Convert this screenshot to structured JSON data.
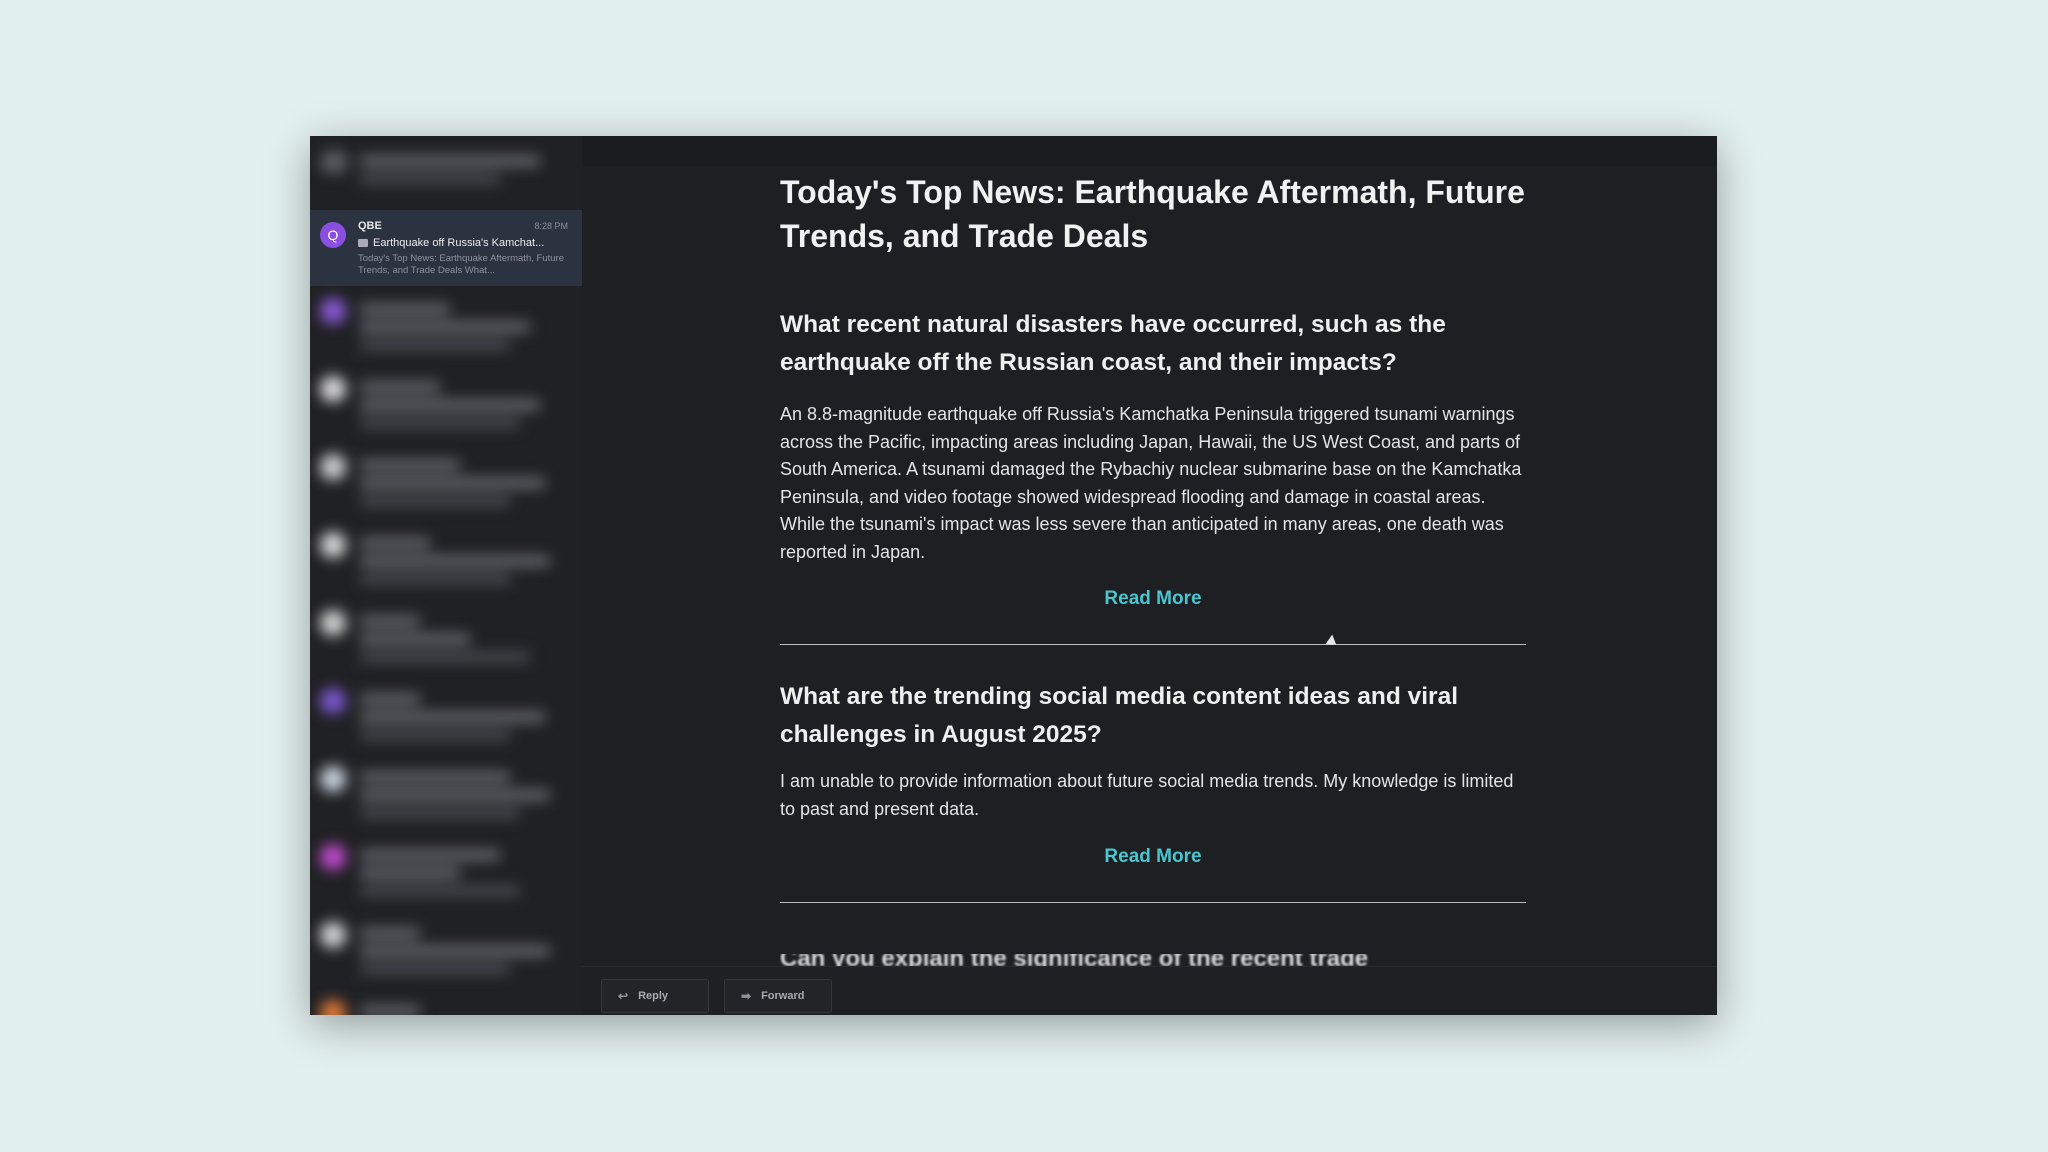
{
  "sidebar": {
    "active_message": {
      "avatar_letter": "Q",
      "sender": "QBE",
      "time": "8:28 PM",
      "subject": "Earthquake off Russia's Kamchat...",
      "preview": "Today's Top News: Earthquake Aftermath, Future Trends, and Trade Deals What..."
    }
  },
  "toolbar": {
    "icons": [
      "check-icon",
      "trash-icon",
      "flag-icon",
      "mail-icon",
      "folder-icon",
      "tag-icon",
      "more-icon",
      "popout-icon"
    ]
  },
  "email": {
    "title": "Today's Top News: Earthquake Aftermath, Future Trends, and Trade Deals",
    "sections": [
      {
        "question": "What recent natural disasters have occurred, such as the earthquake off the Russian coast, and their impacts?",
        "body": "An 8.8-magnitude earthquake off Russia's Kamchatka Peninsula triggered tsunami warnings across the Pacific, impacting areas including Japan, Hawaii, the US West Coast, and parts of South America. A tsunami damaged the Rybachiy nuclear submarine base on the Kamchatka Peninsula, and video footage showed widespread flooding and damage in coastal areas. While the tsunami's impact was less severe than anticipated in many areas, one death was reported in Japan.",
        "link": "Read More"
      },
      {
        "question": "What are the trending social media content ideas and viral challenges in August 2025?",
        "body": "I am unable to provide information about future social media trends. My knowledge is limited to past and present data.",
        "link": "Read More"
      }
    ],
    "cutoff_heading": "Can you explain the significance of the recent trade"
  },
  "footer": {
    "reply_label": "Reply",
    "forward_label": "Forward"
  },
  "colors": {
    "background": "#e3f0f0",
    "window": "#1e1f22",
    "link": "#49c6cf",
    "avatar": "#8a4fe0"
  }
}
